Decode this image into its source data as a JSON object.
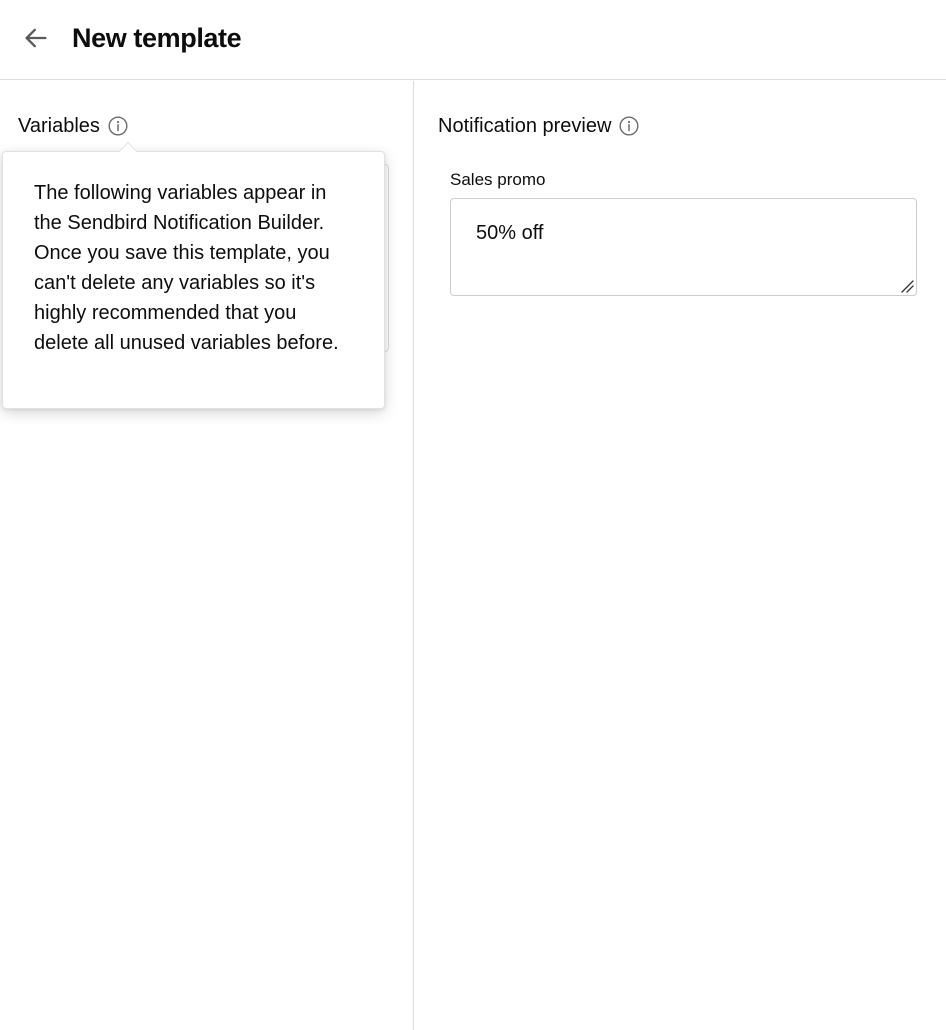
{
  "header": {
    "back_icon": "arrow-left-icon",
    "title": "New template"
  },
  "variables_panel": {
    "title": "Variables",
    "info_icon": "info-circle-icon",
    "tooltip": {
      "text": "The following variables appear in the Sendbird Notification Builder. Once you save this template, you can't delete any variables so it's highly recommended that you delete all unused variables before."
    }
  },
  "preview_panel": {
    "title": "Notification preview",
    "info_icon": "info-circle-icon",
    "field": {
      "label": "Sales promo",
      "value": "50% off",
      "resize_icon": "resize-handle-icon"
    }
  },
  "colors": {
    "text": "#0d0d0d",
    "border": "#dddddd",
    "icon": "#6b6b6b"
  }
}
